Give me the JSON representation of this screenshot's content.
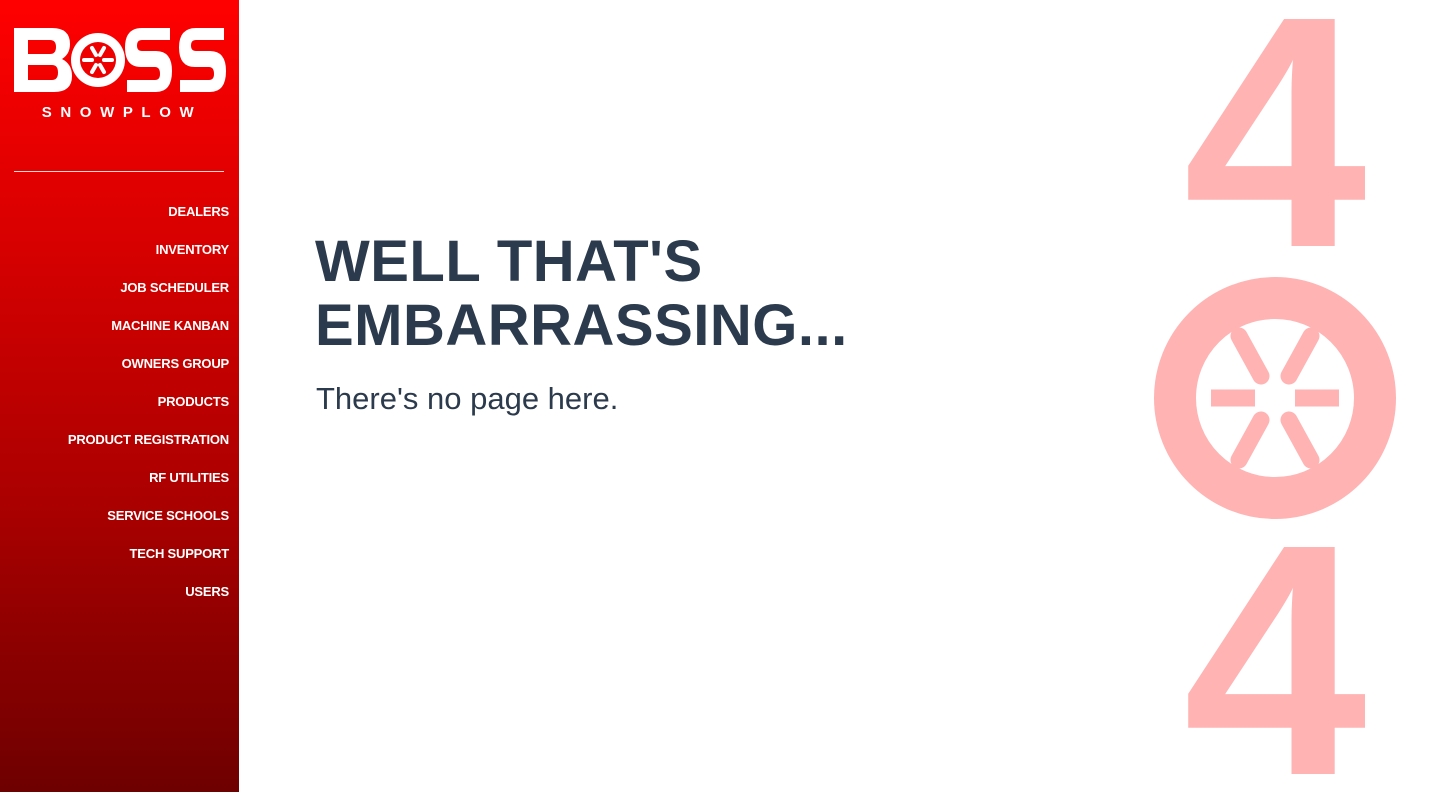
{
  "brand": {
    "logo_text": "BOSS",
    "logo_subtext": "SNOWPLOW",
    "brand_color": "#ff0000",
    "dark_color": "#6e0000"
  },
  "sidebar": {
    "items": [
      {
        "label": "DEALERS"
      },
      {
        "label": "INVENTORY"
      },
      {
        "label": "JOB SCHEDULER"
      },
      {
        "label": "MACHINE KANBAN"
      },
      {
        "label": "OWNERS GROUP"
      },
      {
        "label": "PRODUCTS"
      },
      {
        "label": "PRODUCT REGISTRATION"
      },
      {
        "label": "RF UTILITIES"
      },
      {
        "label": "SERVICE SCHOOLS"
      },
      {
        "label": "TECH SUPPORT"
      },
      {
        "label": "USERS"
      }
    ]
  },
  "main": {
    "title_line1": "WELL THAT'S",
    "title_line2": "EMBARRASSING...",
    "message": "There's no page here.",
    "text_color": "#2b3a4c"
  },
  "error_graphic": {
    "digit_first": "4",
    "digit_last": "4",
    "middle_icon": "boss-wheel-icon",
    "color": "#ffb3b3"
  }
}
